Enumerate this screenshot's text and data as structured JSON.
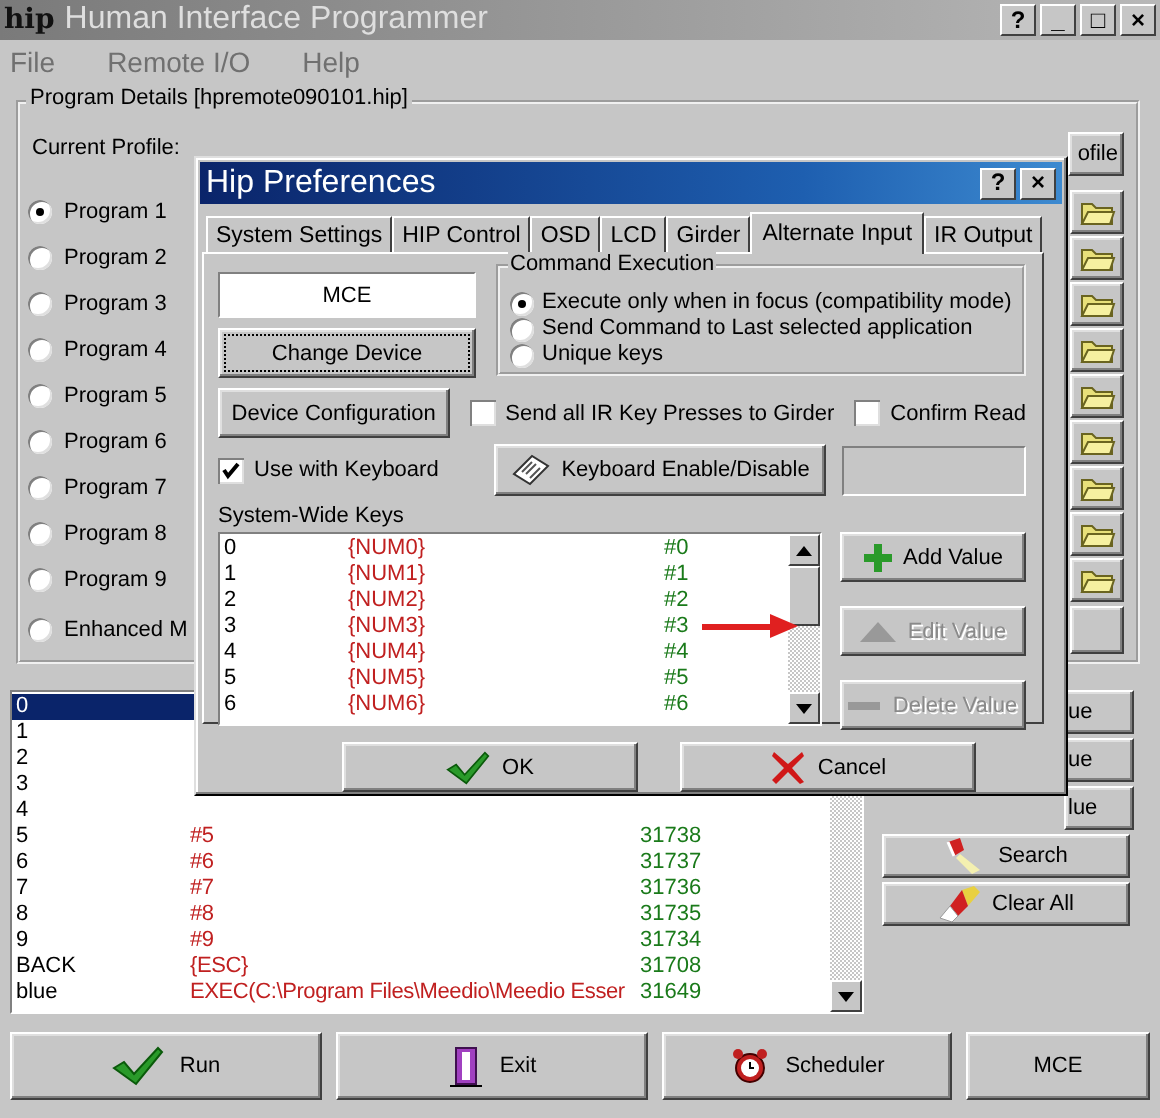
{
  "window": {
    "logo": "hip",
    "title": "Human Interface Programmer",
    "controls": [
      "?",
      "_",
      "□",
      "×"
    ]
  },
  "menu": [
    "File",
    "Remote I/O",
    "Help"
  ],
  "program_details": {
    "title": "Program Details [hpremote090101.hip]",
    "profile_label": "Current Profile:",
    "profile_button": "ofile",
    "programs": [
      {
        "label": "Program 1",
        "selected": true
      },
      {
        "label": "Program 2",
        "selected": false
      },
      {
        "label": "Program 3",
        "selected": false
      },
      {
        "label": "Program 4",
        "selected": false
      },
      {
        "label": "Program 5",
        "selected": false
      },
      {
        "label": "Program 6",
        "selected": false
      },
      {
        "label": "Program 7",
        "selected": false
      },
      {
        "label": "Program 8",
        "selected": false
      },
      {
        "label": "Program 9",
        "selected": false
      }
    ],
    "enhanced": {
      "label": "Enhanced M",
      "selected": false
    }
  },
  "command_list": {
    "rows": [
      {
        "key": "0",
        "selected": true
      },
      {
        "key": "1",
        "selected": false
      },
      {
        "key": "2",
        "selected": false
      },
      {
        "key": "3",
        "selected": false
      },
      {
        "key": "4",
        "selected": false
      },
      {
        "key": "5",
        "command": "#5",
        "code": "31738",
        "selected": false
      },
      {
        "key": "6",
        "command": "#6",
        "code": "31737",
        "selected": false
      },
      {
        "key": "7",
        "command": "#7",
        "code": "31736",
        "selected": false
      },
      {
        "key": "8",
        "command": "#8",
        "code": "31735",
        "selected": false
      },
      {
        "key": "9",
        "command": "#9",
        "code": "31734",
        "selected": false
      },
      {
        "key": "BACK",
        "command": "{ESC}",
        "code": "31708",
        "selected": false
      },
      {
        "key": "blue",
        "command": "EXEC(C:\\Program Files\\Meedio\\Meedio Esser",
        "code": "31649",
        "selected": false
      }
    ]
  },
  "side_buttons": [
    {
      "label": "ue",
      "kind": "partial"
    },
    {
      "label": "ue",
      "kind": "partial"
    },
    {
      "label": "lue",
      "kind": "partial"
    },
    {
      "label": "Search",
      "kind": "search"
    },
    {
      "label": "Clear All",
      "kind": "clear"
    }
  ],
  "bottom_buttons": [
    {
      "label": "Run",
      "kind": "run"
    },
    {
      "label": "Exit",
      "kind": "exit"
    },
    {
      "label": "Scheduler",
      "kind": "scheduler"
    },
    {
      "label": "MCE",
      "kind": "plain"
    }
  ],
  "dialog": {
    "title": "Hip Preferences",
    "controls": [
      "?",
      "×"
    ],
    "tabs": [
      {
        "label": "System Settings",
        "selected": false
      },
      {
        "label": "HIP Control",
        "selected": false
      },
      {
        "label": "OSD",
        "selected": false
      },
      {
        "label": "LCD",
        "selected": false
      },
      {
        "label": "Girder",
        "selected": false
      },
      {
        "label": "Alternate Input",
        "selected": true
      },
      {
        "label": "IR Output",
        "selected": false
      }
    ],
    "device": "MCE",
    "change_device": "Change Device",
    "device_configuration": "Device Configuration",
    "execution": {
      "title": "Command Execution",
      "options": [
        {
          "label": "Execute only when in focus (compatibility mode)",
          "selected": true
        },
        {
          "label": "Send Command to Last selected application",
          "selected": false
        },
        {
          "label": "Unique keys",
          "selected": false
        }
      ]
    },
    "send_all": {
      "label": "Send all IR Key Presses to Girder",
      "checked": false
    },
    "confirm_read": {
      "label": "Confirm Read",
      "checked": false
    },
    "use_keyboard": {
      "label": "Use with Keyboard",
      "checked": true
    },
    "keyboard_button": "Keyboard Enable/Disable",
    "keys_label": "System-Wide Keys",
    "keys": [
      {
        "key": "0",
        "command": "{NUM0}",
        "code": "#0"
      },
      {
        "key": "1",
        "command": "{NUM1}",
        "code": "#1"
      },
      {
        "key": "2",
        "command": "{NUM2}",
        "code": "#2"
      },
      {
        "key": "3",
        "command": "{NUM3}",
        "code": "#3"
      },
      {
        "key": "4",
        "command": "{NUM4}",
        "code": "#4"
      },
      {
        "key": "5",
        "command": "{NUM5}",
        "code": "#5"
      },
      {
        "key": "6",
        "command": "{NUM6}",
        "code": "#6"
      }
    ],
    "actions": [
      {
        "label": "Add Value",
        "kind": "add",
        "disabled": false
      },
      {
        "label": "Edit Value",
        "kind": "edit",
        "disabled": true
      },
      {
        "label": "Delete Value",
        "kind": "delete",
        "disabled": true
      }
    ],
    "ok": "OK",
    "cancel": "Cancel"
  }
}
